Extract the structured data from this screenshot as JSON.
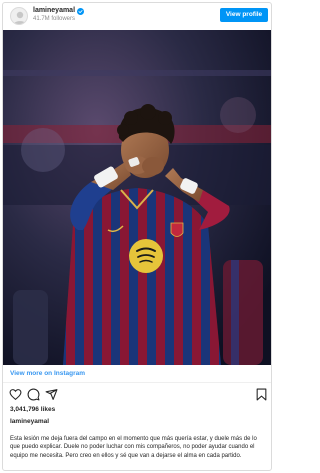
{
  "header": {
    "username": "lamineyamal",
    "followers": "41.7M followers",
    "view_profile_label": "View profile"
  },
  "footer": {
    "view_more_label": "View more on Instagram",
    "likes": "3,041,796 likes",
    "caption_username": "lamineyamal",
    "caption": "Esta lesión me deja fuera del campo en el momento que más quería estar, y duele más de lo que puedo explicar. Duele no poder luchar con mis compañeros, no poder ayudar cuando el equipo me necesita. Pero creo en ellos y sé que van a dejarse el alma en cada partido."
  },
  "icons": {
    "verified": "verified-badge-icon",
    "like": "heart-icon",
    "comment": "comment-icon",
    "share": "share-icon",
    "save": "bookmark-icon"
  },
  "colors": {
    "accent": "#0095f6",
    "link": "#3897f0",
    "jersey_blue": "#1f3f8f",
    "jersey_red": "#a11c3e"
  }
}
